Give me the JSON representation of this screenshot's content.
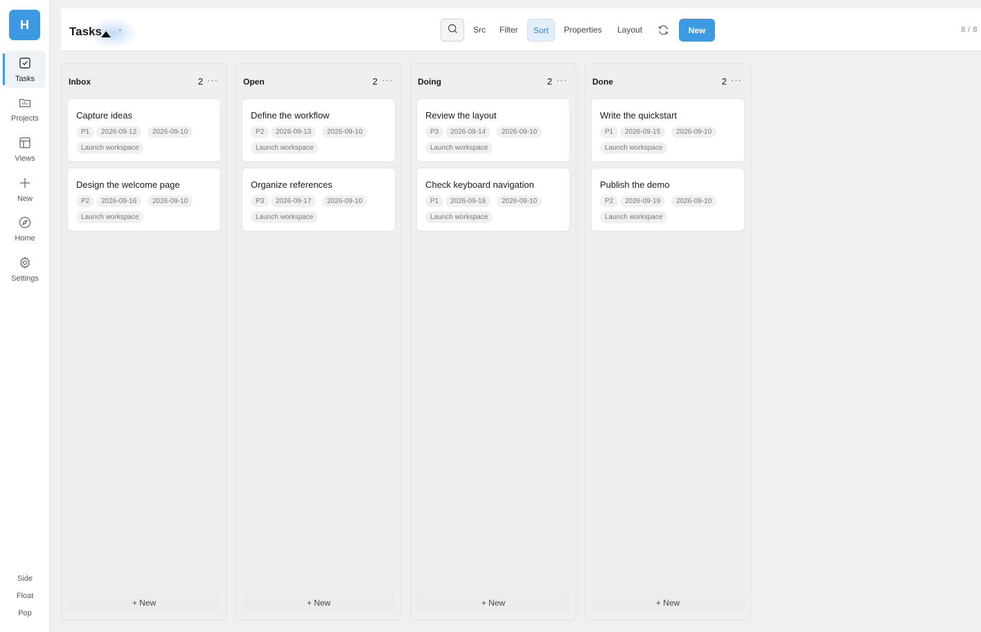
{
  "sidebar": {
    "avatar_letter": "H",
    "nav": [
      {
        "label": "Tasks",
        "icon": "checkbox-icon",
        "active": true
      },
      {
        "label": "Projects",
        "icon": "folder-icon"
      },
      {
        "label": "Views",
        "icon": "layout-icon"
      },
      {
        "label": "New",
        "icon": "plus-icon"
      },
      {
        "label": "Home",
        "icon": "compass-icon"
      },
      {
        "label": "Settings",
        "icon": "gear-icon"
      }
    ],
    "modes": [
      "Side",
      "Float",
      "Pop"
    ]
  },
  "header": {
    "title": "Tasks",
    "add_label": "+",
    "toolbar": {
      "src": "Src",
      "filter": "Filter",
      "sort": "Sort",
      "properties": "Properties",
      "layout": "Layout",
      "new": "New"
    },
    "count": "8 / 8"
  },
  "board": {
    "columns": [
      {
        "title": "Inbox",
        "count": "2",
        "more": "···",
        "new_label": "+ New",
        "cards": [
          {
            "title": "Capture ideas",
            "priority": "P1",
            "date1": "2026-09-12",
            "date2": "2026-09-10",
            "project": "Launch workspace"
          },
          {
            "title": "Design the welcome page",
            "priority": "P2",
            "date1": "2026-09-16",
            "date2": "2026-09-10",
            "project": "Launch workspace"
          }
        ]
      },
      {
        "title": "Open",
        "count": "2",
        "more": "···",
        "new_label": "+ New",
        "cards": [
          {
            "title": "Define the workflow",
            "priority": "P2",
            "date1": "2026-09-13",
            "date2": "2026-09-10",
            "project": "Launch workspace"
          },
          {
            "title": "Organize references",
            "priority": "P3",
            "date1": "2026-09-17",
            "date2": "2026-09-10",
            "project": "Launch workspace"
          }
        ]
      },
      {
        "title": "Doing",
        "count": "2",
        "more": "···",
        "new_label": "+ New",
        "cards": [
          {
            "title": "Review the layout",
            "priority": "P3",
            "date1": "2026-09-14",
            "date2": "2026-09-10",
            "project": "Launch workspace"
          },
          {
            "title": "Check keyboard navigation",
            "priority": "P1",
            "date1": "2026-09-18",
            "date2": "2026-09-10",
            "project": "Launch workspace"
          }
        ]
      },
      {
        "title": "Done",
        "count": "2",
        "more": "···",
        "new_label": "+ New",
        "cards": [
          {
            "title": "Write the quickstart",
            "priority": "P1",
            "date1": "2026-09-15",
            "date2": "2026-09-10",
            "project": "Launch workspace"
          },
          {
            "title": "Publish the demo",
            "priority": "P2",
            "date1": "2026-09-19",
            "date2": "2026-09-10",
            "project": "Launch workspace"
          }
        ]
      }
    ]
  },
  "colors": {
    "accent": "#3b9ae1",
    "sort_active_bg": "#e2effb",
    "sort_active_text": "#2f86d2",
    "board_bg": "#f0f0f0"
  }
}
